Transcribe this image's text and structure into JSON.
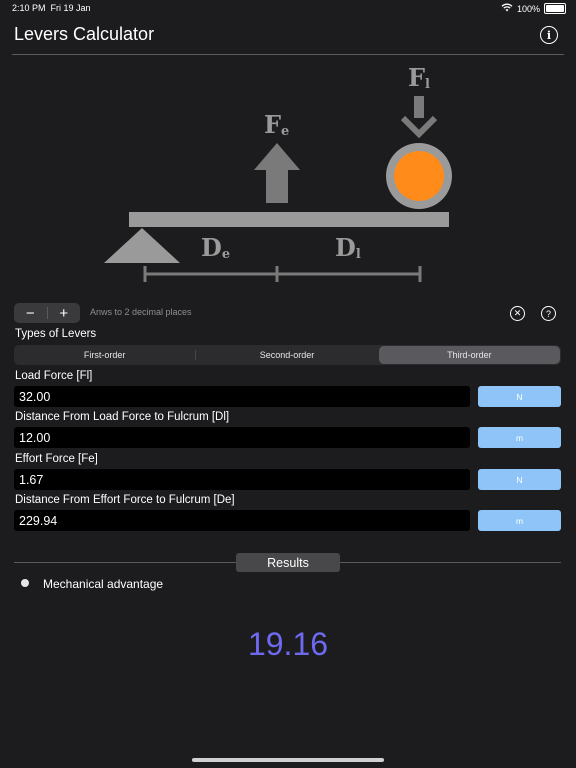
{
  "status": {
    "time": "2:10 PM",
    "date": "Fri 19 Jan",
    "battery": "100%"
  },
  "header": {
    "title": "Levers Calculator"
  },
  "diagram": {
    "fe": "F",
    "fe_sub": "e",
    "fl": "F",
    "fl_sub": "l",
    "de": "D",
    "de_sub": "e",
    "dl": "D",
    "dl_sub": "l",
    "ball_color": "#ff8c1a"
  },
  "controls": {
    "minus": "−",
    "plus": "+",
    "decimals_note": "Anws to 2 decimal places"
  },
  "lever_types": {
    "label": "Types of Levers",
    "options": [
      "First-order",
      "Second-order",
      "Third-order"
    ],
    "selected": "Third-order"
  },
  "fields": [
    {
      "label": "Load Force [Fl]",
      "value": "32.00",
      "unit": "N"
    },
    {
      "label": "Distance From Load Force to Fulcrum [Dl]",
      "value": "12.00",
      "unit": "m"
    },
    {
      "label": "Effort Force [Fe]",
      "value": "1.67",
      "unit": "N"
    },
    {
      "label": "Distance From Effort Force to Fulcrum [De]",
      "value": "229.94",
      "unit": "m"
    }
  ],
  "results": {
    "tag": "Results",
    "item_label": "Mechanical advantage",
    "value": "19.16"
  },
  "colors": {
    "accent_result": "#6d6af0",
    "unit_button": "#8ec4f8"
  }
}
